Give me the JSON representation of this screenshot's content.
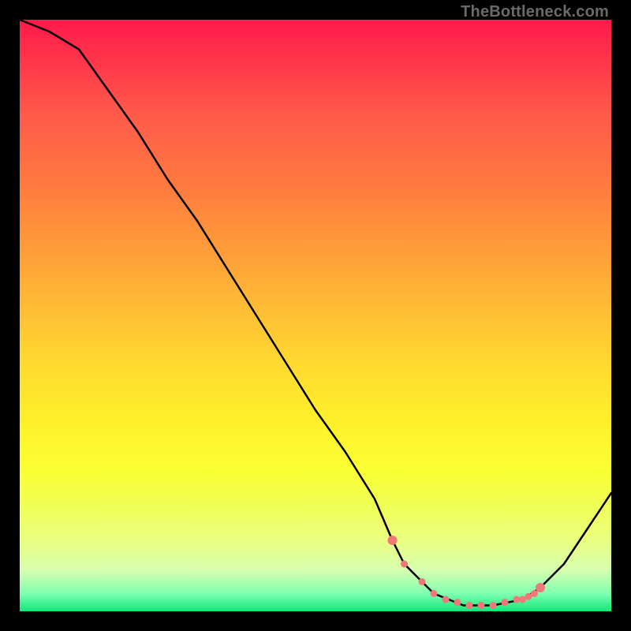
{
  "attribution": "TheBottleneck.com",
  "chart_data": {
    "type": "line",
    "title": "",
    "xlabel": "",
    "ylabel": "",
    "xlim": [
      0,
      100
    ],
    "ylim": [
      0,
      100
    ],
    "series": [
      {
        "name": "bottleneck-curve",
        "x": [
          0,
          5,
          10,
          15,
          20,
          25,
          30,
          35,
          40,
          45,
          50,
          55,
          60,
          63,
          65,
          70,
          75,
          80,
          85,
          88,
          92,
          96,
          100
        ],
        "values": [
          100,
          98,
          95,
          88,
          81,
          73,
          66,
          58,
          50,
          42,
          34,
          27,
          19,
          12,
          8,
          3,
          1,
          1,
          2,
          4,
          8,
          14,
          20
        ]
      }
    ],
    "markers": {
      "name": "highlight-dots",
      "color": "#f07878",
      "x": [
        63,
        65,
        68,
        70,
        72,
        74,
        76,
        78,
        80,
        82,
        84,
        85,
        86,
        87,
        88
      ],
      "values": [
        12,
        8,
        5,
        3,
        2,
        1.5,
        1,
        1,
        1,
        1.5,
        2,
        2,
        2.5,
        3,
        4
      ]
    }
  }
}
